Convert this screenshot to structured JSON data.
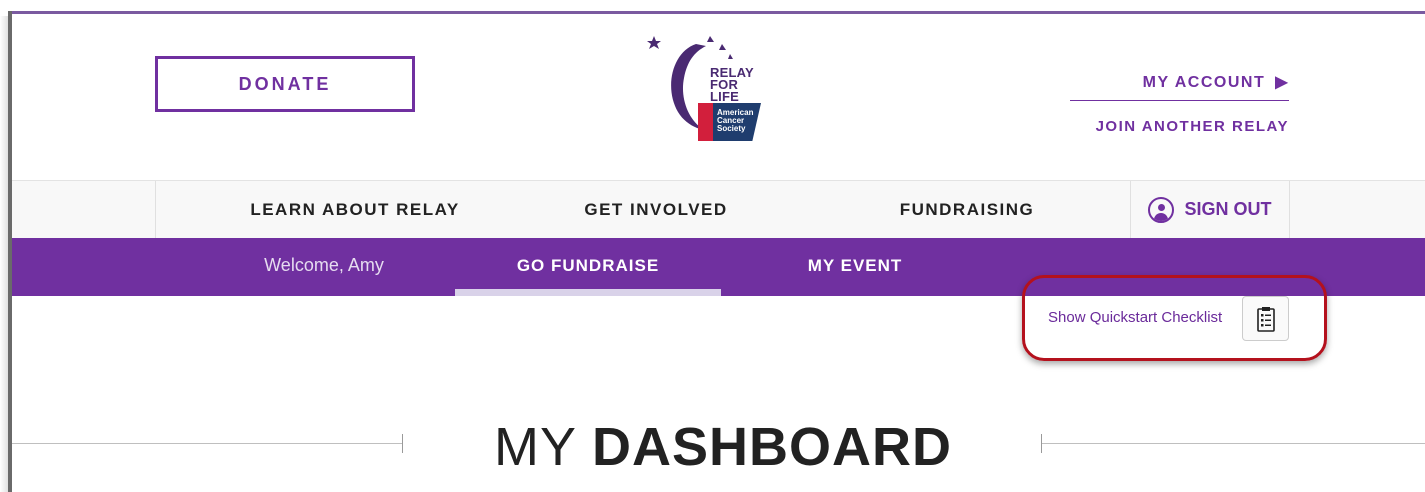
{
  "header": {
    "donate_label": "DONATE",
    "logo": {
      "line1": "RELAY",
      "line2": "FOR LIFE",
      "acs_line1": "American",
      "acs_line2": "Cancer",
      "acs_line3": "Society"
    },
    "my_account_label": "MY ACCOUNT",
    "join_relay_label": "JOIN ANOTHER RELAY"
  },
  "nav": {
    "items": [
      {
        "label": "LEARN ABOUT RELAY"
      },
      {
        "label": "GET INVOLVED"
      },
      {
        "label": "FUNDRAISING"
      }
    ],
    "signout_label": "SIGN OUT"
  },
  "subnav": {
    "welcome": "Welcome, Amy",
    "tabs": [
      {
        "label": "GO FUNDRAISE",
        "active": true
      },
      {
        "label": "MY EVENT",
        "active": false
      }
    ]
  },
  "quickstart": {
    "label": "Show Quickstart Checklist",
    "icon": "clipboard-checklist-icon"
  },
  "dashboard": {
    "title_light": "MY",
    "title_bold": "DASHBOARD"
  },
  "colors": {
    "brand_purple": "#7030a0",
    "highlight_red": "#b4111d",
    "acs_red": "#d21f3c",
    "acs_blue": "#1f3d6e"
  }
}
